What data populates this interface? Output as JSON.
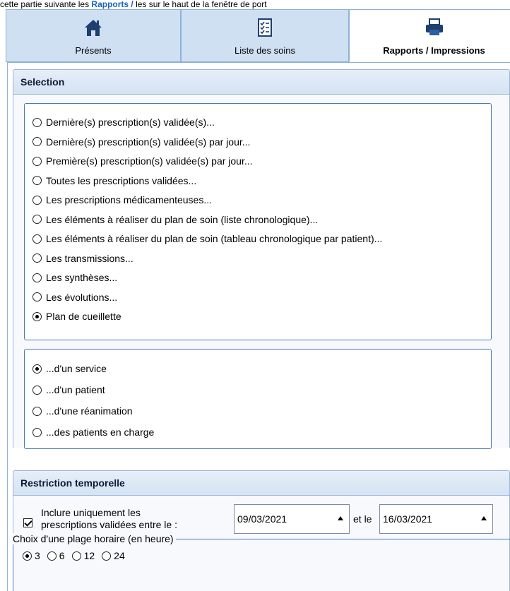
{
  "top_strip": {
    "prefix": "cette partie suivante les ",
    "highlight": "Rapports / ",
    "suffix": "les sur le haut de la fenêtre de port"
  },
  "tabs": [
    {
      "label": "Présents",
      "icon": "home-icon",
      "active": false
    },
    {
      "label": "Liste des soins",
      "icon": "checklist-icon",
      "active": false
    },
    {
      "label": "Rapports / Impressions",
      "icon": "printer-icon",
      "active": true
    }
  ],
  "selection": {
    "title": "Selection",
    "report_options": [
      {
        "label": "Dernière(s) prescription(s) validée(s)...",
        "selected": false
      },
      {
        "label": "Dernière(s) prescription(s) validée(s) par jour...",
        "selected": false
      },
      {
        "label": "Première(s) prescription(s) validée(s) par jour...",
        "selected": false
      },
      {
        "label": "Toutes les prescriptions validées...",
        "selected": false
      },
      {
        "label": "Les prescriptions médicamenteuses...",
        "selected": false
      },
      {
        "label": "Les éléments à réaliser du plan de soin (liste chronologique)...",
        "selected": false
      },
      {
        "label": "Les éléments à réaliser du plan de soin (tableau chronologique par patient)...",
        "selected": false
      },
      {
        "label": "Les transmissions...",
        "selected": false
      },
      {
        "label": "Les synthèses...",
        "selected": false
      },
      {
        "label": "Les évolutions...",
        "selected": false
      },
      {
        "label": "Plan de cueillette",
        "selected": true
      }
    ],
    "scope_options": [
      {
        "label": "...d'un service",
        "selected": true
      },
      {
        "label": "...d'un patient",
        "selected": false
      },
      {
        "label": "...d'une réanimation",
        "selected": false
      },
      {
        "label": "...des patients en charge",
        "selected": false
      }
    ]
  },
  "restriction": {
    "title": "Restriction temporelle",
    "include_checked": true,
    "include_label_line1": "Inclure uniquement les",
    "include_label_line2": "prescriptions validées entre le :",
    "date_from": "09/03/2021",
    "between_label": "et le",
    "date_to": "16/03/2021",
    "hour_range_legend": "Choix d'une plage horaire (en heure)",
    "hour_options": [
      {
        "label": "3",
        "selected": true
      },
      {
        "label": "6",
        "selected": false
      },
      {
        "label": "12",
        "selected": false
      },
      {
        "label": "24",
        "selected": false
      }
    ]
  }
}
